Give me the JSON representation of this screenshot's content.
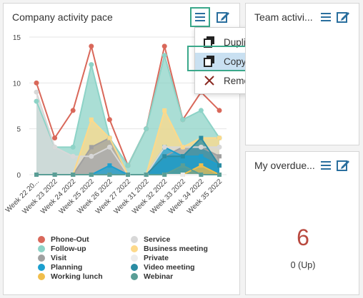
{
  "tiles": {
    "main": {
      "title": "Company activity pace"
    },
    "team": {
      "title": "Team activi..."
    },
    "overdue": {
      "title": "My overdue...",
      "value": "6",
      "sub": "0 (Up)"
    }
  },
  "menu": {
    "items": [
      "Duplicate tile",
      "Copy tile to dashboard",
      "Remove tile"
    ]
  },
  "icons": {
    "menu": "hamburger-icon",
    "edit": "edit-icon",
    "duplicate": "duplicate-icon",
    "copy": "copy-icon",
    "remove": "close-icon"
  },
  "chart_data": {
    "type": "area",
    "categories": [
      "Week 22 20...",
      "Week 23 2022",
      "Week 24 2022",
      "Week 25 2022",
      "Week 26 2022",
      "Week 27 2022",
      "Week 31 2022",
      "Week 32 2022",
      "Week 33 2022",
      "Week 34 2022",
      "Week 35 2022"
    ],
    "ylim": [
      0,
      15
    ],
    "yticks": [
      0,
      5,
      10,
      15
    ],
    "series": [
      {
        "name": "Phone-Out",
        "color": "#d9685a",
        "values": [
          10,
          4,
          7,
          14,
          6,
          1,
          5,
          14,
          6,
          9,
          7
        ]
      },
      {
        "name": "Follow-up",
        "color": "#8dd3c7",
        "values": [
          8,
          3,
          3,
          12,
          4,
          1,
          5,
          13,
          6,
          7,
          4
        ]
      },
      {
        "name": "Visit",
        "color": "#a0a0a0",
        "values": [
          0,
          0,
          0,
          3,
          4,
          0,
          0,
          2,
          3,
          3,
          2
        ]
      },
      {
        "name": "Planning",
        "color": "#1b9fcf",
        "values": [
          0,
          0,
          0,
          0,
          1,
          0,
          0,
          3,
          2,
          2,
          1
        ]
      },
      {
        "name": "Working lunch",
        "color": "#f0be4c",
        "values": [
          0,
          0,
          0,
          0,
          0,
          0,
          0,
          0,
          0,
          1,
          0
        ]
      },
      {
        "name": "Service",
        "color": "#d8d8d8",
        "values": [
          9,
          3,
          2,
          2,
          3,
          0,
          0,
          3,
          3,
          3,
          3
        ]
      },
      {
        "name": "Business meeting",
        "color": "#fdd98a",
        "values": [
          0,
          0,
          0,
          6,
          4,
          0,
          0,
          7,
          3,
          4,
          4
        ]
      },
      {
        "name": "Private",
        "color": "#ececec",
        "values": [
          0,
          0,
          0,
          0,
          0,
          0,
          0,
          0,
          0,
          0,
          0
        ]
      },
      {
        "name": "Video meeting",
        "color": "#2a8ca3",
        "values": [
          0,
          0,
          0,
          0,
          0,
          0,
          0,
          2,
          2,
          4,
          1
        ]
      },
      {
        "name": "Webinar",
        "color": "#5a9e96",
        "values": [
          0,
          0,
          0,
          0,
          0,
          0,
          0,
          0,
          1,
          0,
          0
        ]
      }
    ]
  }
}
